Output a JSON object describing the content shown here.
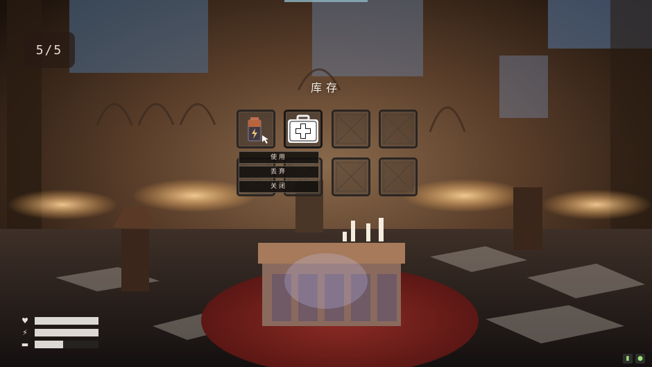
{
  "hud": {
    "counter": "5/5",
    "stats": [
      {
        "icon": "heart-icon",
        "glyph": "♥",
        "level": 1.0
      },
      {
        "icon": "stamina-bolt-icon",
        "glyph": "⚡",
        "level": 1.0
      },
      {
        "icon": "battery-icon",
        "glyph": "▬",
        "level": 0.45
      }
    ]
  },
  "inventory": {
    "title": "库存",
    "slots": [
      {
        "item": "battery-icon",
        "filled": true
      },
      {
        "item": "medkit-icon",
        "filled": true,
        "selected": true
      },
      {
        "item": "empty-slot",
        "filled": false
      },
      {
        "item": "empty-slot",
        "filled": false
      },
      {
        "item": "empty-slot",
        "filled": false
      },
      {
        "item": "empty-slot",
        "filled": false
      },
      {
        "item": "empty-slot",
        "filled": false
      },
      {
        "item": "empty-slot",
        "filled": false
      }
    ],
    "context_menu": [
      "使用",
      "丢弃",
      "关闭"
    ]
  },
  "system_icons": [
    "microphone-icon",
    "status-icon"
  ],
  "colors": {
    "accent": "#dcd8d3",
    "menu_bg": "#12100e",
    "slot_border": "#2a2522"
  }
}
